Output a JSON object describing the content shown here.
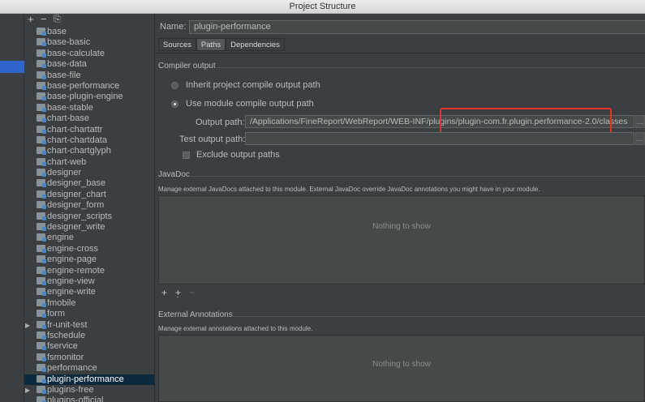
{
  "window": {
    "title": "Project Structure"
  },
  "tree": {
    "items": [
      {
        "label": "base",
        "expandable": false
      },
      {
        "label": "base-basic",
        "expandable": false
      },
      {
        "label": "base-calculate",
        "expandable": false
      },
      {
        "label": "base-data",
        "expandable": false
      },
      {
        "label": "base-file",
        "expandable": false
      },
      {
        "label": "base-performance",
        "expandable": false
      },
      {
        "label": "base-plugin-engine",
        "expandable": false
      },
      {
        "label": "base-stable",
        "expandable": false
      },
      {
        "label": "chart-base",
        "expandable": false
      },
      {
        "label": "chart-chartattr",
        "expandable": false
      },
      {
        "label": "chart-chartdata",
        "expandable": false
      },
      {
        "label": "chart-chartglyph",
        "expandable": false
      },
      {
        "label": "chart-web",
        "expandable": false
      },
      {
        "label": "designer",
        "expandable": false
      },
      {
        "label": "designer_base",
        "expandable": false
      },
      {
        "label": "designer_chart",
        "expandable": false
      },
      {
        "label": "designer_form",
        "expandable": false
      },
      {
        "label": "designer_scripts",
        "expandable": false
      },
      {
        "label": "designer_write",
        "expandable": false
      },
      {
        "label": "engine",
        "expandable": false
      },
      {
        "label": "engine-cross",
        "expandable": false
      },
      {
        "label": "engine-page",
        "expandable": false
      },
      {
        "label": "engine-remote",
        "expandable": false
      },
      {
        "label": "engine-view",
        "expandable": false
      },
      {
        "label": "engine-write",
        "expandable": false
      },
      {
        "label": "fmobile",
        "expandable": false
      },
      {
        "label": "form",
        "expandable": false
      },
      {
        "label": "fr-unit-test",
        "expandable": true
      },
      {
        "label": "fschedule",
        "expandable": false
      },
      {
        "label": "fservice",
        "expandable": false
      },
      {
        "label": "fsmonitor",
        "expandable": false
      },
      {
        "label": "performance",
        "expandable": false
      },
      {
        "label": "plugin-performance",
        "expandable": false,
        "selected": true
      },
      {
        "label": "plugins-free",
        "expandable": true
      },
      {
        "label": "plugins-official",
        "expandable": false
      }
    ]
  },
  "module": {
    "name_label": "Name:",
    "name_value": "plugin-performance",
    "tabs": [
      "Sources",
      "Paths",
      "Dependencies"
    ],
    "active_tab": "Paths"
  },
  "compiler_output": {
    "title": "Compiler output",
    "inherit_label": "Inherit project compile output path",
    "use_module_label": "Use module compile output path",
    "output_path_label": "Output path:",
    "output_path_value": "/Applications/FineReport/WebReport/WEB-INF/plugins/plugin-com.fr.plugin.performance-2.0/classes",
    "test_output_label": "Test output path:",
    "test_output_value": "",
    "exclude_label": "Exclude output paths"
  },
  "javadoc": {
    "title": "JavaDoc",
    "desc": "Manage external JavaDocs attached to this module. External JavaDoc override JavaDoc annotations you might have in your module.",
    "empty": "Nothing to show"
  },
  "external_annotations": {
    "title": "External Annotations",
    "desc": "Manage external annotations attached to this module.",
    "empty": "Nothing to show"
  },
  "colors": {
    "highlight": "#e8322a",
    "selection": "#0d293e"
  }
}
